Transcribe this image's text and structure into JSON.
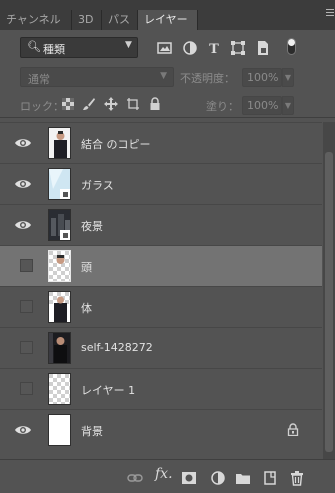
{
  "tabs": [
    {
      "label": "チャンネル",
      "active": false
    },
    {
      "label": "3D",
      "active": false
    },
    {
      "label": "パス",
      "active": false
    },
    {
      "label": "レイヤー",
      "active": true
    }
  ],
  "filter": {
    "label": "種類",
    "icons": [
      "image-filter-icon",
      "adjustment-filter-icon",
      "type-filter-icon",
      "shape-filter-icon",
      "smart-object-filter-icon"
    ]
  },
  "blend": {
    "mode": "通常",
    "opacity_label": "不透明度：",
    "opacity_value": "100%"
  },
  "lock": {
    "label": "ロック：",
    "fill_label": "塗り：",
    "fill_value": "100%"
  },
  "layers": [
    {
      "name": "結合 のコピー",
      "visible": true,
      "selected": false,
      "locked": false
    },
    {
      "name": "ガラス",
      "visible": true,
      "selected": false,
      "locked": false
    },
    {
      "name": "夜景",
      "visible": true,
      "selected": false,
      "locked": false
    },
    {
      "name": "頭",
      "visible": false,
      "selected": true,
      "locked": false
    },
    {
      "name": "体",
      "visible": false,
      "selected": false,
      "locked": false
    },
    {
      "name": "self-1428272",
      "visible": false,
      "selected": false,
      "locked": false
    },
    {
      "name": "レイヤー 1",
      "visible": false,
      "selected": false,
      "locked": false
    },
    {
      "name": "背景",
      "visible": true,
      "selected": false,
      "locked": true
    }
  ],
  "colors": {
    "panel": "#535353",
    "selected_row": "#737373",
    "tabbar": "#3c3c3c"
  }
}
